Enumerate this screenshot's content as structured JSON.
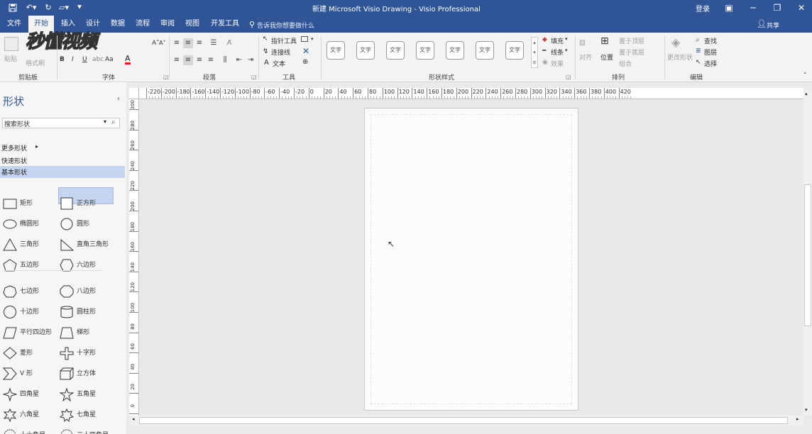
{
  "window": {
    "title": "新建 Microsoft Visio Drawing  -  Visio Professional",
    "login": "登录",
    "share": "共享"
  },
  "tabs": [
    {
      "label": "文件"
    },
    {
      "label": "开始"
    },
    {
      "label": "插入"
    },
    {
      "label": "设计"
    },
    {
      "label": "数据"
    },
    {
      "label": "流程"
    },
    {
      "label": "审阅"
    },
    {
      "label": "视图"
    },
    {
      "label": "开发工具"
    }
  ],
  "tell_me": "告诉我你想要做什么",
  "watermark": "秒懂视频",
  "ribbon": {
    "clipboard": {
      "paste": "粘贴",
      "format_painter": "格式刷",
      "group": "剪贴板"
    },
    "font": {
      "group": "字体",
      "bold": "B",
      "italic": "I",
      "underline": "U",
      "case": "Aa",
      "color": "A"
    },
    "paragraph": {
      "group": "段落"
    },
    "tools": {
      "pointer": "指针工具",
      "connector": "连接线",
      "text": "文本",
      "group": "工具"
    },
    "shape_styles": {
      "sample": "文字",
      "group": "形状样式",
      "fill": "填充",
      "line": "线条",
      "effect": "效果"
    },
    "arrange": {
      "align": "对齐",
      "position": "位置",
      "bring_front": "置于顶层",
      "send_back": "置于底层",
      "group_btn": "组合",
      "group": "排列"
    },
    "editing": {
      "change_shape": "更改形状",
      "find": "查找",
      "layers": "图层",
      "select": "选择",
      "group": "编辑"
    }
  },
  "shapes_panel": {
    "title": "形状",
    "search_placeholder": "搜索形状",
    "more_shapes": "更多形状",
    "quick_shapes": "快速形状",
    "basic_shapes": "基本形状",
    "items": [
      {
        "label": "矩形",
        "icon": "rectangle-icon"
      },
      {
        "label": "正方形",
        "icon": "square-icon"
      },
      {
        "label": "椭圆形",
        "icon": "ellipse-icon"
      },
      {
        "label": "圆形",
        "icon": "circle-icon"
      },
      {
        "label": "三角形",
        "icon": "triangle-icon"
      },
      {
        "label": "直角三角形",
        "icon": "right-triangle-icon"
      },
      {
        "label": "五边形",
        "icon": "pentagon-icon"
      },
      {
        "label": "六边形",
        "icon": "hexagon-icon"
      },
      {
        "label": "七边形",
        "icon": "heptagon-icon"
      },
      {
        "label": "八边形",
        "icon": "octagon-icon"
      },
      {
        "label": "十边形",
        "icon": "decagon-icon"
      },
      {
        "label": "圆柱形",
        "icon": "cylinder-icon"
      },
      {
        "label": "平行四边形",
        "icon": "parallelogram-icon"
      },
      {
        "label": "梯形",
        "icon": "trapezoid-icon"
      },
      {
        "label": "菱形",
        "icon": "diamond-icon"
      },
      {
        "label": "十字形",
        "icon": "cross-icon"
      },
      {
        "label": "V 形",
        "icon": "chevron-icon"
      },
      {
        "label": "立方体",
        "icon": "cube-icon"
      },
      {
        "label": "四角星",
        "icon": "star4-icon"
      },
      {
        "label": "五角星",
        "icon": "star5-icon"
      },
      {
        "label": "六角星",
        "icon": "star6-icon"
      },
      {
        "label": "七角星",
        "icon": "star7-icon"
      },
      {
        "label": "十六角星",
        "icon": "star16-icon"
      },
      {
        "label": "二十四角星",
        "icon": "star24-icon"
      }
    ]
  },
  "ruler": {
    "top": [
      "-220",
      "-200",
      "-180",
      "-160",
      "-140",
      "-120",
      "-100",
      "-80",
      "-60",
      "-40",
      "-20",
      "0",
      "20",
      "40",
      "60",
      "80",
      "100",
      "120",
      "140",
      "160",
      "180",
      "200",
      "220",
      "240",
      "260",
      "280",
      "300",
      "320",
      "340",
      "360",
      "380",
      "400",
      "420"
    ],
    "left": [
      "300",
      "280",
      "260",
      "240",
      "220",
      "200",
      "180",
      "160",
      "140",
      "120",
      "100",
      "80",
      "60",
      "40",
      "20",
      "0"
    ]
  },
  "colors": {
    "accent": "#2f5597",
    "selected": "#c5d5f0",
    "red": "#e02020"
  }
}
